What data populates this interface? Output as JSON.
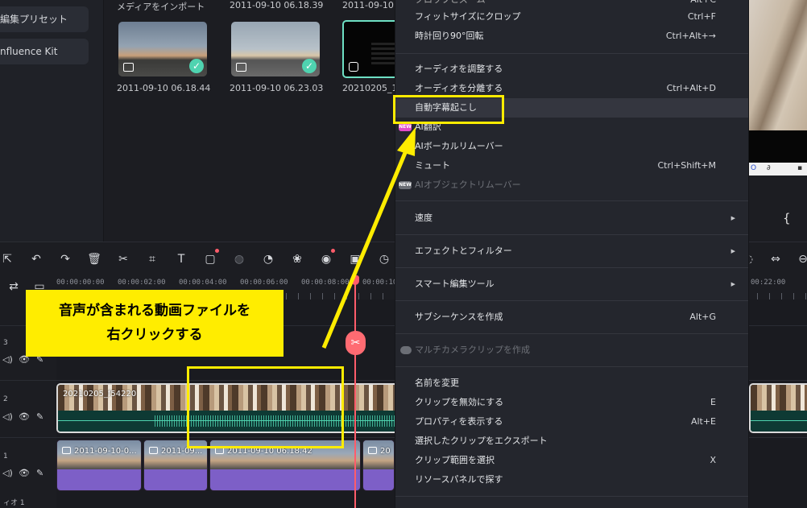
{
  "sidebar": {
    "items": [
      {
        "label": "編集プリセット"
      },
      {
        "label": "nfluence Kit"
      }
    ]
  },
  "media": {
    "import_label": "メディアをインポート",
    "items": [
      {
        "name": "2011-09-10 06.18.44",
        "header": "2011-09-10 06.18.39"
      },
      {
        "name": "2011-09-10 06.23.03",
        "header": "2011-09-10 0"
      },
      {
        "name": "20210205_15"
      }
    ]
  },
  "player": {
    "bar_glyph": "{"
  },
  "timeline": {
    "ruler_ticks": [
      "00:00:00:00",
      "00:00:02:00",
      "00:00:04:00",
      "00:00:06:00",
      "00:00:08:00",
      "00:00:10:",
      "00:22:00"
    ],
    "tracks": [
      {
        "number": "3"
      },
      {
        "number": "2"
      },
      {
        "number": "1"
      }
    ],
    "track_footer": "ィオ 1",
    "video_clip_title": "20210205_f54220",
    "image_clips": [
      "2011-09-10-0...",
      "2011-09...",
      "2011-09-10 06.18.42",
      "20"
    ]
  },
  "context_menu": {
    "items": [
      {
        "label": "フィットサイズにクロップ",
        "shortcut": "Ctrl+F"
      },
      {
        "label": "時計回り90°回転",
        "shortcut": "Ctrl+Alt+→"
      },
      {
        "label": "オーディオを調整する",
        "shortcut": ""
      },
      {
        "label": "オーディオを分離する",
        "shortcut": "Ctrl+Alt+D"
      },
      {
        "label": "自動字幕起こし",
        "shortcut": ""
      },
      {
        "label": "AI翻訳",
        "shortcut": "",
        "badge": "NEW"
      },
      {
        "label": "AIボーカルリムーバー",
        "shortcut": ""
      },
      {
        "label": "ミュート",
        "shortcut": "Ctrl+Shift+M"
      },
      {
        "label": "AIオブジェクトリムーバー",
        "shortcut": "",
        "badge": "NEW",
        "disabled": true
      },
      {
        "label": "速度",
        "shortcut": ""
      },
      {
        "label": "エフェクトとフィルター",
        "shortcut": ""
      },
      {
        "label": "スマート編集ツール",
        "shortcut": ""
      },
      {
        "label": "サブシーケンスを作成",
        "shortcut": "Alt+G"
      },
      {
        "label": "マルチカメラクリップを作成",
        "shortcut": "",
        "disabled": true
      },
      {
        "label": "名前を変更",
        "shortcut": ""
      },
      {
        "label": "クリップを無効にする",
        "shortcut": "E"
      },
      {
        "label": "プロパティを表示する",
        "shortcut": "Alt+E"
      },
      {
        "label": "選択したクリップをエクスポート",
        "shortcut": ""
      },
      {
        "label": "クリップ範囲を選択",
        "shortcut": "X"
      },
      {
        "label": "リソースパネルで探す",
        "shortcut": ""
      }
    ],
    "top_partial_shortcut": "Alt+C"
  },
  "annotation": {
    "callout_line1": "音声が含まれる動画ファイルを",
    "callout_line2": "右クリックする",
    "highlight_color": "#ffec00"
  },
  "colors": {
    "accent": "#4fd3b0",
    "playhead": "#ff5c6a",
    "new_badge": "#e24bc9"
  }
}
